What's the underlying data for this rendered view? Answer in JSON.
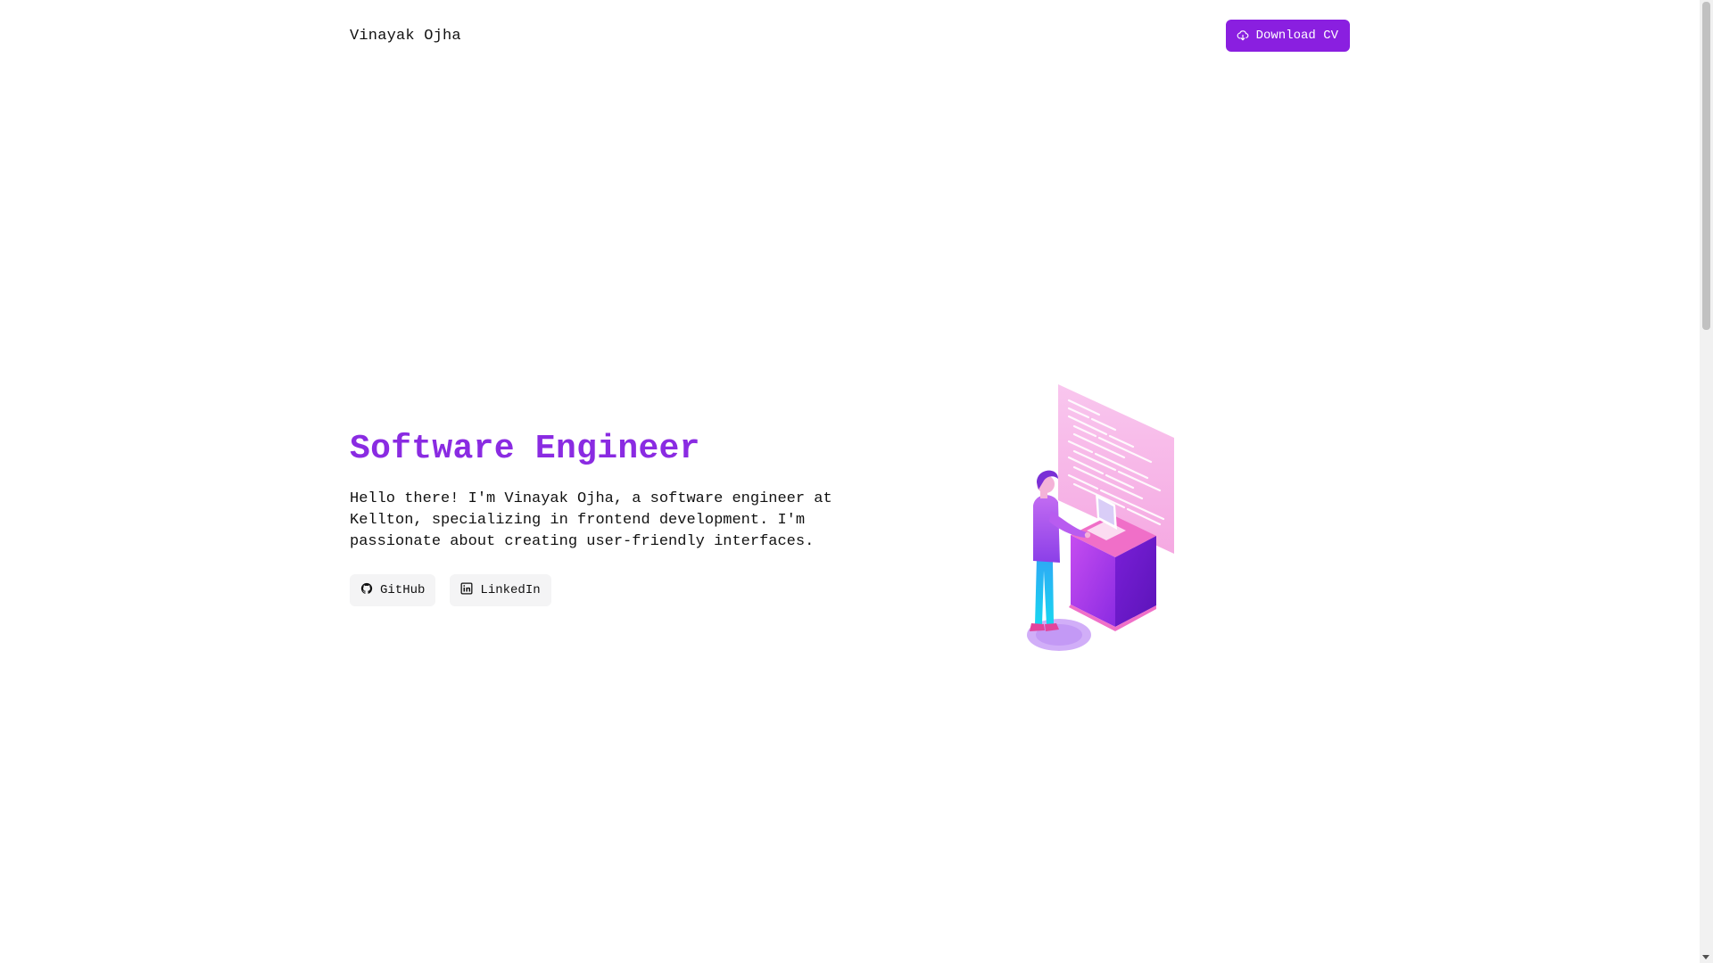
{
  "header": {
    "brand": "Vinayak Ojha",
    "download_cv_label": "Download CV",
    "download_icon": "cloud-download-icon"
  },
  "hero": {
    "title": "Software Engineer",
    "description": "Hello there! I'm Vinayak Ojha, a software engineer at Kellton, specializing in frontend development. I'm passionate about creating user-friendly interfaces.",
    "buttons": [
      {
        "label": "GitHub",
        "icon": "github-icon"
      },
      {
        "label": "LinkedIn",
        "icon": "linkedin-icon"
      }
    ]
  },
  "illustration": {
    "icon": "developer-at-laptop-illustration"
  },
  "colors": {
    "accent": "#8a2be2",
    "button_primary": "#8a1fe0",
    "button_secondary": "#f4f4f5",
    "illustration_pink": "#f7b8e6",
    "illustration_purple": "#9b3ff0",
    "illustration_cyan": "#1fc4f0"
  }
}
